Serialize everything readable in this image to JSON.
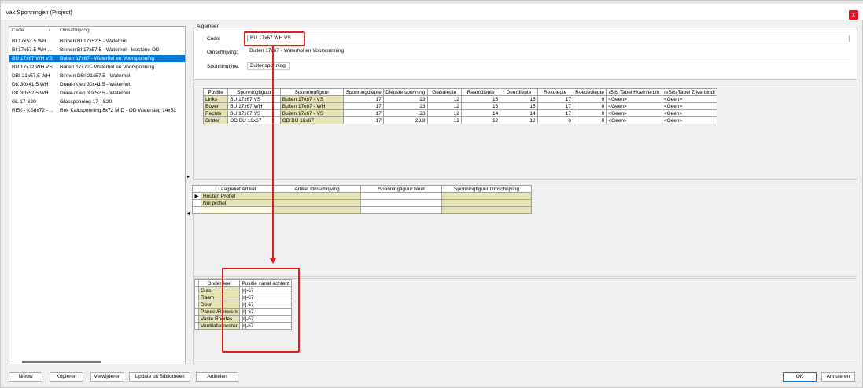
{
  "window": {
    "title": "Vak Sponningen (Project)",
    "close_glyph": "x"
  },
  "list": {
    "headers": {
      "code": "Code",
      "sep": "/",
      "desc": "Omschrijving"
    },
    "rows": [
      {
        "code": "BI 17x52.5 WH",
        "desc": "Binnen BI 17x52.5 - Waterhol"
      },
      {
        "code": "BI 17x57.5 WH ...",
        "desc": "Binnen BI 17x57.5 - Waterhol - Isostone OD"
      },
      {
        "code": "BU 17x67 WH VS",
        "desc": "Buiten 17x67 - Waterhol en Voorsponning"
      },
      {
        "code": "BU 17x72 WH VS",
        "desc": "Buiten 17x72 - Waterhol en Voorsponning"
      },
      {
        "code": "DBI 21x57.5 WH",
        "desc": "Binnen DBI 21x57.5 - Waterhol"
      },
      {
        "code": "DK 30x41.5 WH",
        "desc": "Draai-/Kiep 30x41.5 - Waterhol"
      },
      {
        "code": "DK 30x52.5 WH",
        "desc": "Draai-/Kiep 30x52.5 - Waterhol"
      },
      {
        "code": "GL 17 S20",
        "desc": "Glassponning 17 - S20"
      },
      {
        "code": "REK - KS8x72 - ...",
        "desc": "Rek Kalksponning 8x72 MID - OD Waterslag 14x52"
      }
    ]
  },
  "algemeen": {
    "legend": "Algemeen",
    "code_label": "Code:",
    "code_value": "BU 17x67 WH VS",
    "desc_label": "Omschrijving:",
    "desc_value": "Buiten 17x67 - Waterhol en Voorsponning",
    "type_label": "Sponningtype:",
    "type_value": "Buitensponning",
    "chevron": "⌄"
  },
  "positions": {
    "headers": [
      "Positie",
      "Sponningfiguur",
      "Sponningfiguur",
      "Sponningdiepte",
      "Diepste sponning",
      "Glasdiepte",
      "Raamdiepte",
      "Deurdiepte",
      "Rekdiepte",
      "Roedediepte",
      "/Slis Tabel Hoekverbin",
      "n/Slis Tabel Zijverbindi"
    ],
    "rows": [
      [
        "Links",
        "BU 17x67 VS",
        "Buiten 17x67 - VS",
        "17",
        "23",
        "12",
        "15",
        "15",
        "17",
        "0",
        "<Geen>",
        "<Geen>"
      ],
      [
        "Boven",
        "BU 17x67 WH",
        "Buiten 17x67 - WH",
        "17",
        "23",
        "12",
        "15",
        "15",
        "17",
        "0",
        "<Geen>",
        "<Geen>"
      ],
      [
        "Rechts",
        "BU 17x67 VS",
        "Buiten 17x67 - VS",
        "17",
        "23",
        "12",
        "14",
        "14",
        "17",
        "0",
        "<Geen>",
        "<Geen>"
      ],
      [
        "Onder",
        "OD BU 16x67",
        "OD BU 16x67",
        "17",
        "28.8",
        "12",
        "12",
        "12",
        "0",
        "0",
        "<Geen>",
        "<Geen>"
      ]
    ]
  },
  "laagreliëf": {
    "headers": [
      "Laagreliëf Artikel",
      "Artikel Omschrijving",
      "Sponningfiguur Neut",
      "Sponningfiguur Omschrijving"
    ],
    "rows": [
      {
        "marker": "▶",
        "cells": [
          "Houten Profiel",
          "",
          "",
          ""
        ]
      },
      {
        "marker": "",
        "cells": [
          "Nul profiel",
          "",
          "",
          ""
        ]
      },
      {
        "marker": "",
        "cells": [
          "",
          "",
          "",
          ""
        ]
      }
    ]
  },
  "onderdelen": {
    "headers": [
      "Onderdeel",
      "Positie vanaf achterz"
    ],
    "rows": [
      [
        "Glas",
        "[r]-67"
      ],
      [
        "Raam",
        "[r]-67"
      ],
      [
        "Deur",
        "[r]-67"
      ],
      [
        "Paneel/Rekwerk",
        "[r]-67"
      ],
      [
        "Vaste Roedes",
        "[r]-67"
      ],
      [
        "Ventilatierooster",
        "[r]-67"
      ]
    ]
  },
  "splitter": {
    "right_arrow": "▸",
    "left_arrow": "◂"
  },
  "buttons": {
    "nieuw": "Nieuw",
    "kopieren": "Kopieren",
    "verwijderen": "Verwijderen",
    "update": "Update uit Bibliotheek",
    "artikelen": "Artikelen",
    "ok": "OK",
    "annuleren": "Annuleren"
  },
  "colors": {
    "selection": "#0078d7",
    "highlight_cell": "#e6e3b4",
    "annotation": "#e02020",
    "close": "#e81123"
  }
}
